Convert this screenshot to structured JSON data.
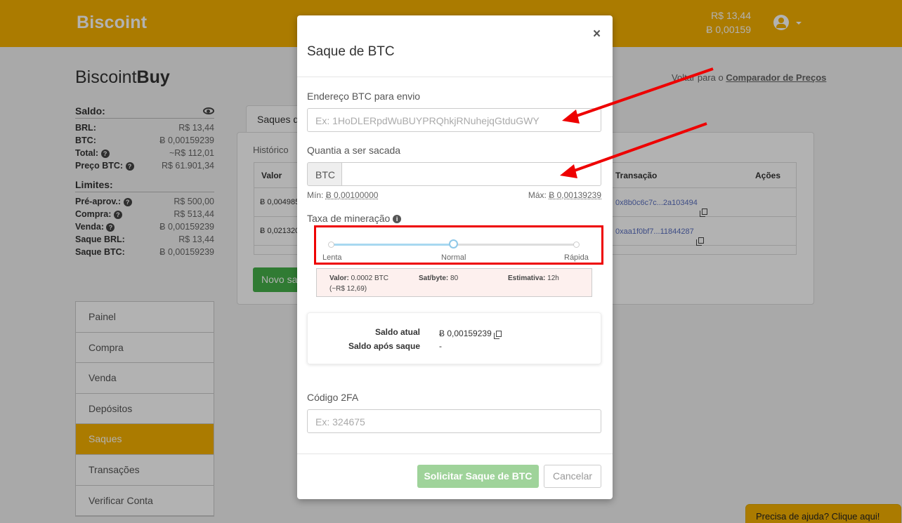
{
  "header": {
    "logo": "Biscoint",
    "balance_brl": "R$ 13,44",
    "balance_btc": "Ƀ 0,00159"
  },
  "page": {
    "brand_light": "Biscoint",
    "brand_bold": "Buy",
    "back_link_prefix": "Voltar para o",
    "back_link_bold": "Comparador de Preços"
  },
  "saldo": {
    "title": "Saldo:",
    "rows": [
      {
        "k": "BRL:",
        "v": "R$ 13,44"
      },
      {
        "k": "BTC:",
        "v": "Ƀ 0,00159239"
      },
      {
        "k": "Total:",
        "v": "~R$ 112,01"
      },
      {
        "k": "Preço BTC:",
        "v": "R$ 61.901,34"
      }
    ]
  },
  "limites": {
    "title": "Limites:",
    "rows": [
      {
        "k": "Pré-aprov.:",
        "v": "R$ 500,00"
      },
      {
        "k": "Compra:",
        "v": "R$ 513,44"
      },
      {
        "k": "Venda:",
        "v": "Ƀ 0,00159239"
      },
      {
        "k": "Saque BRL:",
        "v": "R$ 13,44"
      },
      {
        "k": "Saque BTC:",
        "v": "Ƀ 0,00159239"
      }
    ]
  },
  "menu": [
    "Painel",
    "Compra",
    "Venda",
    "Depósitos",
    "Saques",
    "Transações",
    "Verificar Conta"
  ],
  "background": {
    "tab_label": "Saques d",
    "history_label": "Histórico",
    "col_valor": "Valor",
    "col_transacao": "Transação",
    "col_acoes": "Ações",
    "row1_valor": "Ƀ 0,004985",
    "row1_tx": "0x8b0c6c7c...2a103494",
    "row2_valor": "Ƀ 0,021320",
    "row2_tx": "0xaa1f0bf7...11844287",
    "new_button": "Novo sa"
  },
  "modal": {
    "title": "Saque de BTC",
    "close": "×",
    "address_label": "Endereço BTC para envio",
    "address_placeholder": "Ex: 1HoDLERpdWuBUYPRQhkjRNuhejqGtduGWY",
    "amount_label": "Quantia a ser sacada",
    "amount_addon": "BTC",
    "min_label": "Mín:",
    "min_value": "Ƀ 0,00100000",
    "max_label": "Máx:",
    "max_value": "Ƀ 0,00139239",
    "fee_label": "Taxa de mineração",
    "fee_options": [
      "Lenta",
      "Normal",
      "Rápida"
    ],
    "fee_selected": "Normal",
    "estimate": {
      "valor_label": "Valor:",
      "valor": "0.0002 BTC",
      "valor_brl": "(~R$ 12,69)",
      "satbyte_label": "Sat/byte:",
      "satbyte": "80",
      "estimativa_label": "Estimativa:",
      "estimativa": "12h"
    },
    "saldo_atual_label": "Saldo atual",
    "saldo_atual": "Ƀ 0,00159239",
    "saldo_apos_label": "Saldo após saque",
    "saldo_apos": "-",
    "twofa_label": "Código 2FA",
    "twofa_placeholder": "Ex: 324675",
    "submit_label": "Solicitar Saque de BTC",
    "cancel_label": "Cancelar"
  },
  "help_chat": "Precisa de ajuda? Clique aqui!",
  "colors": {
    "brand_yellow": "#f5b000",
    "annotation_red": "#e00000",
    "success_green": "#46b04a"
  }
}
